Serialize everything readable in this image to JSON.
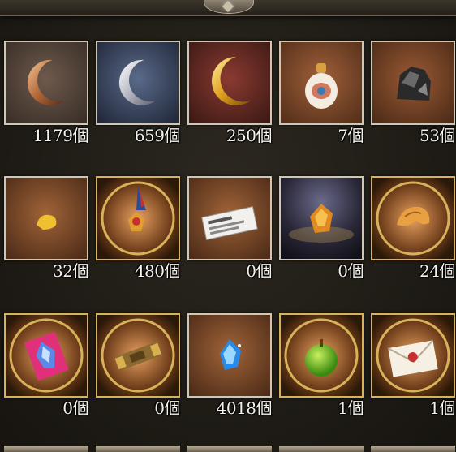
{
  "items": [
    {
      "icon": "bronze-crescent-moon-icon",
      "count": "1179個"
    },
    {
      "icon": "silver-crescent-moon-icon",
      "count": "659個"
    },
    {
      "icon": "gold-crescent-moon-icon",
      "count": "250個"
    },
    {
      "icon": "perfume-bottle-icon",
      "count": "7個"
    },
    {
      "icon": "dark-ore-icon",
      "count": "53個"
    },
    {
      "icon": "gold-nugget-icon",
      "count": "32個"
    },
    {
      "icon": "medal-icon",
      "count": "480個"
    },
    {
      "icon": "ticket-icon",
      "count": "0個"
    },
    {
      "icon": "amber-crystal-icon",
      "count": "0個"
    },
    {
      "icon": "golden-pastry-icon",
      "count": "24個"
    },
    {
      "icon": "crystal-card-icon",
      "count": "0個"
    },
    {
      "icon": "scroll-icon",
      "count": "0個"
    },
    {
      "icon": "blue-crystal-icon",
      "count": "4018個"
    },
    {
      "icon": "green-apple-icon",
      "count": "1個"
    },
    {
      "icon": "sealed-letter-icon",
      "count": "1個"
    }
  ],
  "colors": {
    "count_text": "#f4f1ea",
    "square_frame": "#cfc6b6",
    "round_frame": "#d8b25a"
  }
}
